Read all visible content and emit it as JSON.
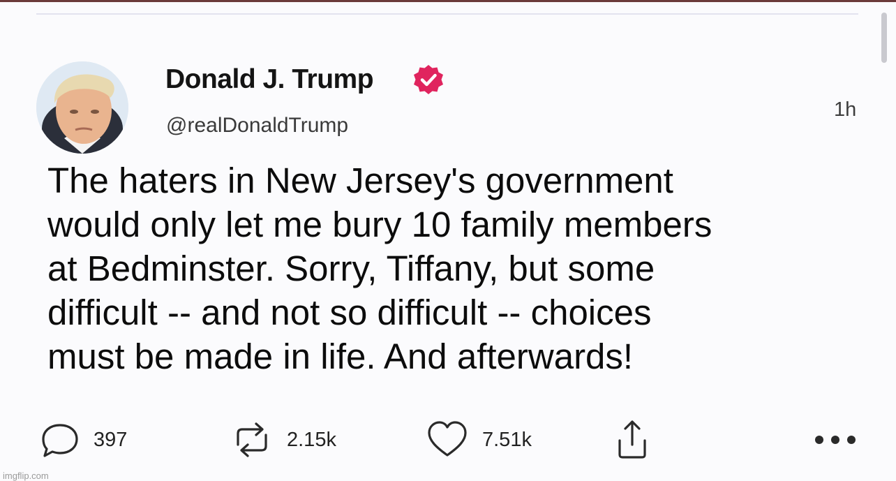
{
  "colors": {
    "verified_badge": "#e0245e",
    "background": "#fbfbfd",
    "text": "#0c0c0c"
  },
  "author": {
    "display_name": "Donald J. Trump",
    "handle": "@realDonaldTrump",
    "verified_icon": "verified-badge-icon",
    "avatar_icon": "profile-photo"
  },
  "timestamp": "1h",
  "tweet": {
    "text": "The haters in New Jersey's government\nwould only let me bury 10 family members\nat Bedminster.  Sorry, Tiffany, but some\ndifficult -- and not so difficult -- choices\nmust be made in life.  And afterwards!"
  },
  "actions": {
    "reply": {
      "icon": "comment-icon",
      "count": "397"
    },
    "retweet": {
      "icon": "retweet-icon",
      "count": "2.15k"
    },
    "like": {
      "icon": "heart-icon",
      "count": "7.51k"
    },
    "share": {
      "icon": "share-icon"
    },
    "more": {
      "icon": "more-icon"
    }
  },
  "watermark": "imgflip.com"
}
